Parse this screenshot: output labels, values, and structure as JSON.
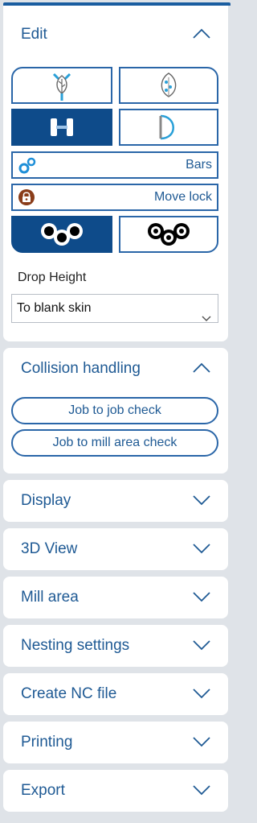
{
  "colors": {
    "accent": "#1f5a94",
    "button_border": "#2a66a8",
    "button_dark": "#0e4b8a",
    "background": "#dfe3e8",
    "panel": "#ffffff",
    "lock_icon": "#8a3d1a"
  },
  "edit": {
    "title": "Edit",
    "expanded": true,
    "icons": [
      "tree-sprout-icon",
      "leaf-icon",
      "bars-clamp-icon",
      "d-shape-icon",
      "gear-pair-icon",
      "padlock-icon",
      "three-circles-icon",
      "three-circles-outline-icon"
    ],
    "bars_label": "Bars",
    "move_lock_label": "Move lock",
    "drop_height_label": "Drop Height",
    "drop_height_value": "To blank skin"
  },
  "collision": {
    "title": "Collision handling",
    "expanded": true,
    "job_to_job_label": "Job to job check",
    "job_to_mill_label": "Job to mill area check"
  },
  "sections": [
    {
      "title": "Display"
    },
    {
      "title": "3D View"
    },
    {
      "title": "Mill area"
    },
    {
      "title": "Nesting settings"
    },
    {
      "title": "Create NC file"
    },
    {
      "title": "Printing"
    },
    {
      "title": "Export"
    }
  ]
}
